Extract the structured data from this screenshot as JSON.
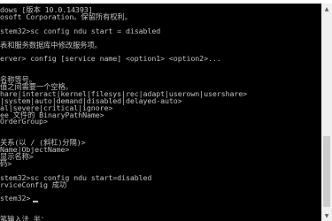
{
  "console": {
    "lines": [
      "dows [版本 10.0.14393]",
      "osoft Corporation。保留所有权利。",
      "",
      "stem32>sc config ndu start = disabled",
      "",
      "表和服务数据库中修改服务项。",
      "",
      "erver> config [service name] <option1> <option2>...",
      "",
      "",
      "名称等号。",
      "值之间需要一个空格。",
      "hare|interact|kernel|filesys|rec|adapt|userown|usershare>",
      "|system|auto|demand|disabled|delayed-auto>",
      "al|severe|critical|ignore>",
      "ee 文件的 BinaryPathName>",
      "OrderGroup>",
      "",
      "",
      "关系(以 / (斜杠)分隔)>",
      "Name|ObjectName>",
      "显示名称>",
      "码>",
      "",
      "stem32>sc config ndu start=disabled",
      "rviceConfig 成功",
      "",
      "stem32>",
      "",
      "",
      "笔输入法 半："
    ],
    "text_color": "#c0c0c0",
    "background_color": "#000000"
  },
  "scrollbar": {
    "up_arrow_icon": "triangle-up-icon",
    "down_arrow_icon": "triangle-down-icon",
    "up_arrow_glyph": "▲",
    "down_arrow_glyph": "▼"
  }
}
